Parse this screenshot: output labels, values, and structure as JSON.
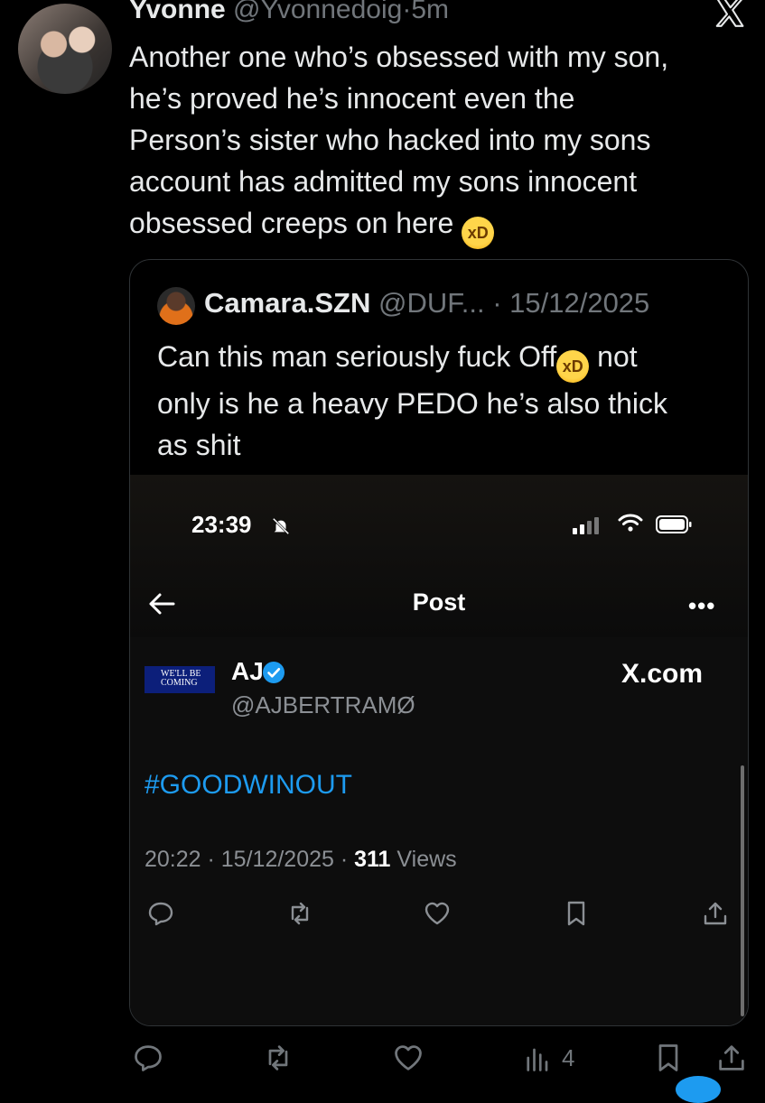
{
  "tweet": {
    "author_name": "Yvonne",
    "author_handle": "@Yvonnedoig",
    "time": "5m",
    "text_lines": [
      "Another one who’s obsessed with my son,",
      "he’s proved he’s innocent even the",
      "Person’s sister who hacked into my sons",
      "account has admitted my sons innocent",
      "obsessed creeps on here"
    ],
    "emoji": "rolling-on-floor-laughing"
  },
  "quote": {
    "author_name": "Camara.SZN",
    "author_handle": "@DUF...",
    "date": "15/12/2025",
    "text_line1_a": "Can this man seriously fuck Off",
    "text_line1_b": " not",
    "text_line2": "only is he a heavy PEDO he’s also thick",
    "text_line3": "as shit"
  },
  "screenshot": {
    "status_time": "23:39",
    "title": "Post",
    "more": "•••",
    "avatar_text": "WE'LL BE COMING",
    "author_name": "AJ",
    "author_handle": "@AJBERTRAMØ",
    "source": "X.com",
    "hashtag": "#GOODWINOUT",
    "time": "20:22",
    "date": "15/12/2025",
    "views_count": "311",
    "views_label": "Views"
  },
  "actions": {
    "views_count": "4"
  },
  "colors": {
    "background": "#000000",
    "text": "#e7e9ea",
    "muted": "#71767b",
    "link": "#1d9bf0"
  }
}
